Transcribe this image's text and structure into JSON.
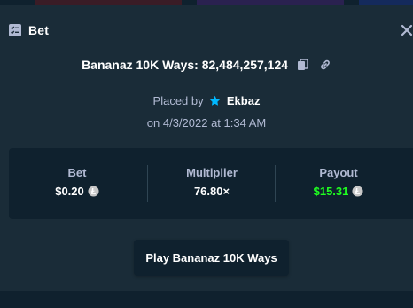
{
  "modal": {
    "title": "Bet",
    "icons": {
      "title": "bet-list-icon",
      "close": "close-icon",
      "copy": "copy-icon",
      "link": "link-icon",
      "user": "star-icon",
      "currency": "litecoin-icon"
    }
  },
  "bet": {
    "game": "Bananaz 10K Ways",
    "id": "82,484,257,124",
    "headline": "Bananaz 10K Ways: 82,484,257,124",
    "placed_by_label": "Placed by",
    "user": "Ekbaz",
    "date_label": "on 4/3/2022 at 1:34 AM"
  },
  "stats": [
    {
      "label": "Bet",
      "value": "$0.20",
      "currency": true
    },
    {
      "label": "Multiplier",
      "value": "76.80×",
      "currency": false
    },
    {
      "label": "Payout",
      "value": "$15.31",
      "currency": true,
      "highlight": true
    }
  ],
  "play_button": "Play Bananaz 10K Ways",
  "colors": {
    "background": "#1a2c38",
    "panel": "#0f212e",
    "muted_text": "#b1bad3",
    "payout": "#1fff20",
    "star": "#00b8ff"
  }
}
